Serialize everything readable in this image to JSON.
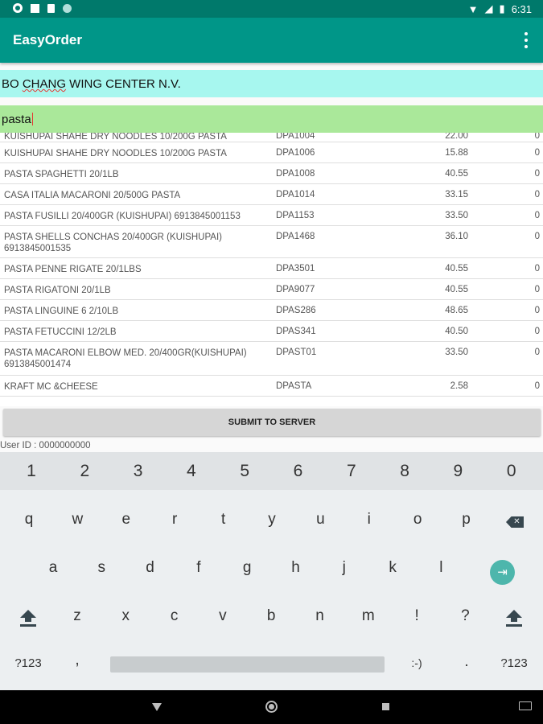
{
  "status_bar": {
    "time": "6:31"
  },
  "app_bar": {
    "title": "EasyOrder",
    "menu_icon": "more-vert-icon"
  },
  "customer": {
    "prefix": "BO ",
    "highlight": "CHANG",
    "suffix": " WING CENTER N.V."
  },
  "search": {
    "value": "pasta"
  },
  "products": [
    {
      "name": "KUISHUPAI SHAHE DRY NOODLES 10/200G PASTA",
      "code": "DPA1004",
      "price": "22.00",
      "qty": "0"
    },
    {
      "name": "KUISHUPAI SHAHE DRY NOODLES 10/200G PASTA",
      "code": "DPA1006",
      "price": "15.88",
      "qty": "0"
    },
    {
      "name": "PASTA SPAGHETTI 20/1LB",
      "code": "DPA1008",
      "price": "40.55",
      "qty": "0"
    },
    {
      "name": "CASA ITALIA MACARONI 20/500G PASTA",
      "code": "DPA1014",
      "price": "33.15",
      "qty": "0"
    },
    {
      "name": "PASTA FUSILLI 20/400GR (KUISHUPAI) 6913845001153",
      "code": "DPA1153",
      "price": "33.50",
      "qty": "0"
    },
    {
      "name": "PASTA SHELLS CONCHAS 20/400GR (KUISHUPAI) 6913845001535",
      "code": "DPA1468",
      "price": "36.10",
      "qty": "0"
    },
    {
      "name": "PASTA PENNE RIGATE 20/1LBS",
      "code": "DPA3501",
      "price": "40.55",
      "qty": "0"
    },
    {
      "name": "PASTA RIGATONI 20/1LB",
      "code": "DPA9077",
      "price": "40.55",
      "qty": "0"
    },
    {
      "name": "PASTA LINGUINE 6 2/10LB",
      "code": "DPAS286",
      "price": "48.65",
      "qty": "0"
    },
    {
      "name": "PASTA FETUCCINI 12/2LB",
      "code": "DPAS341",
      "price": "40.50",
      "qty": "0"
    },
    {
      "name": "PASTA MACARONI ELBOW MED. 20/400GR(KUISHUPAI) 6913845001474",
      "code": "DPAST01",
      "price": "33.50",
      "qty": "0"
    },
    {
      "name": "KRAFT MC &CHEESE",
      "code": "DPASTA",
      "price": "2.58",
      "qty": "0"
    }
  ],
  "submit_label": "SUBMIT TO SERVER",
  "user_id": "User ID : 0000000000",
  "keyboard": {
    "numbers": [
      "1",
      "2",
      "3",
      "4",
      "5",
      "6",
      "7",
      "8",
      "9",
      "0"
    ],
    "row1": [
      "q",
      "w",
      "e",
      "r",
      "t",
      "y",
      "u",
      "i",
      "o",
      "p"
    ],
    "row2": [
      "a",
      "s",
      "d",
      "f",
      "g",
      "h",
      "j",
      "k",
      "l"
    ],
    "row3": [
      "z",
      "x",
      "c",
      "v",
      "b",
      "n",
      "m",
      "!",
      "?"
    ],
    "symbols_label": "?123",
    "comma": ",",
    "smiley": ":-)",
    "period": "."
  }
}
